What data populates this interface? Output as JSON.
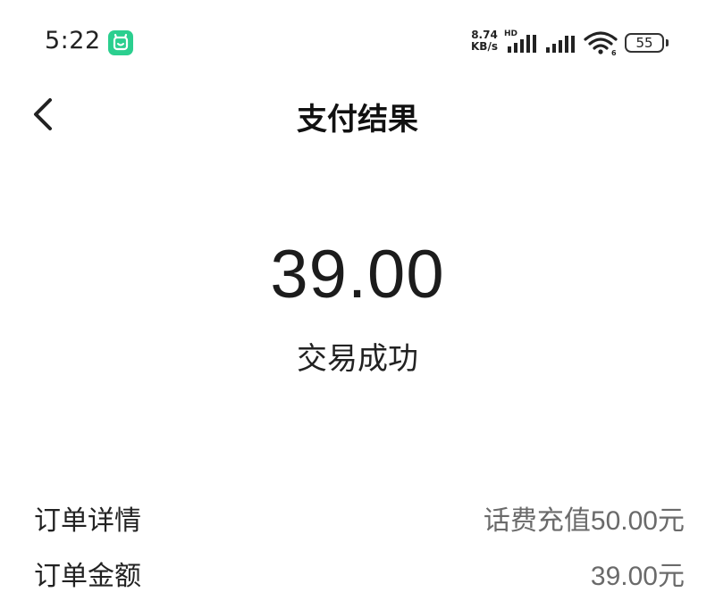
{
  "status_bar": {
    "time": "5:22",
    "net_speed_value": "8.74",
    "net_speed_unit": "KB/s",
    "network_badge": "HD",
    "battery_level": "55",
    "icons": [
      "app-notification-icon",
      "signal-icon",
      "signal-icon",
      "wifi-icon",
      "battery-icon"
    ],
    "accent_color": "#2bcf8f"
  },
  "header": {
    "back_icon": "chevron-left-icon",
    "title": "支付结果"
  },
  "result": {
    "amount": "39.00",
    "status": "交易成功"
  },
  "details": [
    {
      "label": "订单详情",
      "value": "话费充值50.00元"
    },
    {
      "label": "订单金额",
      "value": "39.00元"
    }
  ]
}
